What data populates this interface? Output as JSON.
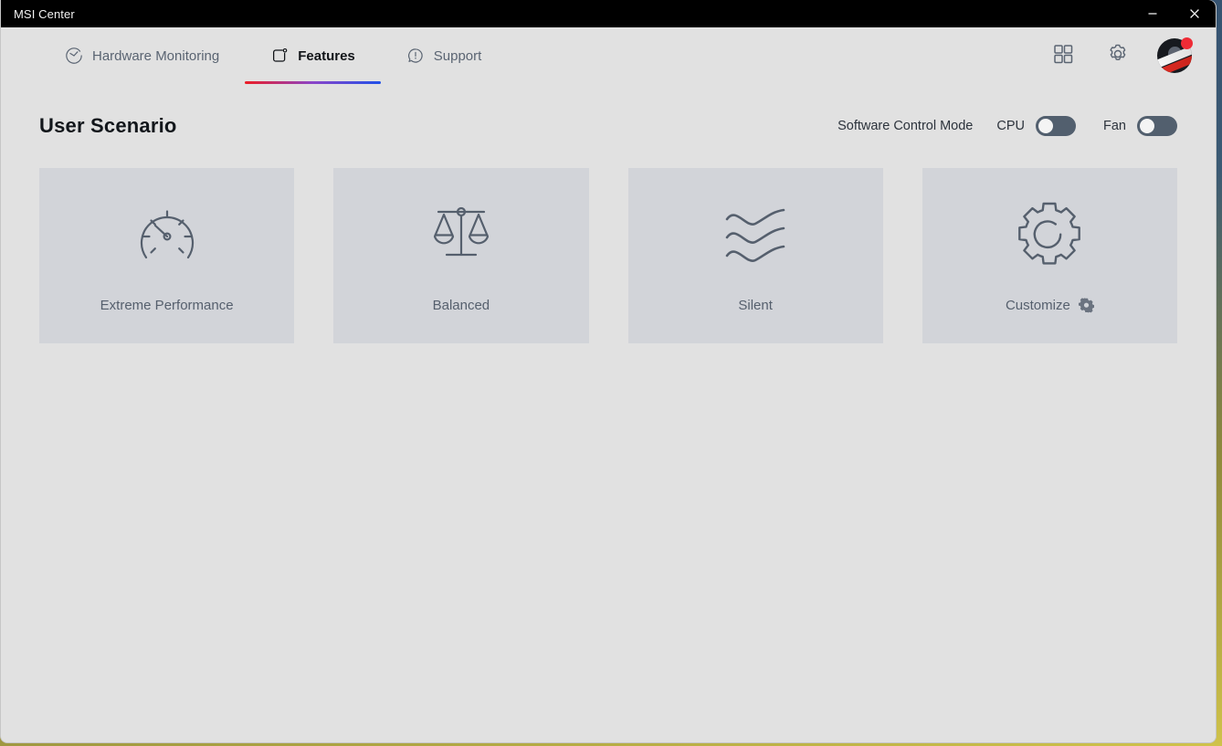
{
  "window": {
    "title": "MSI Center",
    "controls": [
      {
        "name": "minimize",
        "label": "–"
      },
      {
        "name": "close",
        "label": "✕"
      }
    ]
  },
  "nav": {
    "tabs": [
      {
        "id": "hardware-monitoring",
        "label": "Hardware Monitoring",
        "icon": "gauge-icon",
        "active": false
      },
      {
        "id": "features",
        "label": "Features",
        "icon": "features-icon",
        "active": true
      },
      {
        "id": "support",
        "label": "Support",
        "icon": "support-icon",
        "active": false
      }
    ],
    "actions": [
      {
        "id": "apps-grid",
        "icon": "grid-icon"
      },
      {
        "id": "settings",
        "icon": "gear-icon"
      }
    ],
    "avatar": {
      "icon": "user-avatar",
      "badge": true
    }
  },
  "main": {
    "page_title": "User Scenario",
    "control_mode": {
      "label": "Software Control Mode",
      "toggles": [
        {
          "id": "cpu",
          "label": "CPU",
          "on": false
        },
        {
          "id": "fan",
          "label": "Fan",
          "on": false
        }
      ]
    },
    "scenarios": [
      {
        "id": "extreme-performance",
        "label": "Extreme Performance",
        "icon": "speedometer-icon",
        "has_settings": false
      },
      {
        "id": "balanced",
        "label": "Balanced",
        "icon": "scales-icon",
        "has_settings": false
      },
      {
        "id": "silent",
        "label": "Silent",
        "icon": "waves-icon",
        "has_settings": false
      },
      {
        "id": "customize",
        "label": "Customize",
        "icon": "gear-outline-icon",
        "has_settings": true
      }
    ]
  },
  "colors": {
    "page_background": "#e1e1e1",
    "card_background": "#d2d4d9",
    "titlebar_background": "#000000",
    "accent_gradient_start": "#ec1c24",
    "accent_gradient_end": "#2050e8",
    "icon_color": "#555f6d",
    "toggle_off_track": "#525f6e",
    "badge_red": "#ee2b35"
  }
}
